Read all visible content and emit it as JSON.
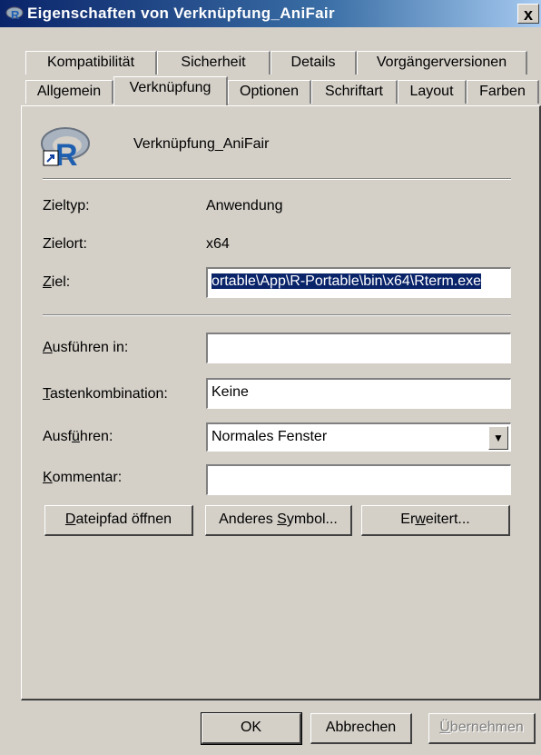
{
  "window": {
    "title": "Eigenschaften von Verknüpfung_AniFair",
    "close_label": "x"
  },
  "tabs_row1": [
    {
      "label": "Kompatibilität"
    },
    {
      "label": "Sicherheit"
    },
    {
      "label": "Details"
    },
    {
      "label": "Vorgängerversionen"
    }
  ],
  "tabs_row2": [
    {
      "label": "Allgemein"
    },
    {
      "label": "Verknüpfung",
      "active": true
    },
    {
      "label": "Optionen"
    },
    {
      "label": "Schriftart"
    },
    {
      "label": "Layout"
    },
    {
      "label": "Farben"
    }
  ],
  "shortcut": {
    "name": "Verknüpfung_AniFair",
    "icon": "r-app-shortcut-icon",
    "icon_letter": "R"
  },
  "fields": {
    "zieltyp_label": "Zieltyp:",
    "zieltyp_value": "Anwendung",
    "zielort_label": "Zielort:",
    "zielort_value": "x64",
    "ziel_label_hot": "Z",
    "ziel_label_rest": "iel:",
    "ziel_value": "ortable\\App\\R-Portable\\bin\\x64\\Rterm.exe",
    "ausfuehren_in_hot": "A",
    "ausfuehren_in_rest": "usführen in:",
    "ausfuehren_in_value": "",
    "tasten_hot": "T",
    "tasten_rest": "astenkombination:",
    "tasten_value": "Keine",
    "ausfuehren_pre": "Ausf",
    "ausfuehren_hot": "ü",
    "ausfuehren_post": "hren:",
    "ausfuehren_value": "Normales Fenster",
    "kommentar_hot": "K",
    "kommentar_rest": "ommentar:",
    "kommentar_value": ""
  },
  "buttons": {
    "dateipfad_hot": "D",
    "dateipfad_rest": "ateipfad öffnen",
    "symbol_pre": "Anderes ",
    "symbol_hot": "S",
    "symbol_post": "ymbol...",
    "erweitert_pre": "Er",
    "erweitert_hot": "w",
    "erweitert_post": "eitert...",
    "ok": "OK",
    "abbrechen": "Abbrechen",
    "uebernehmen_hot": "Ü",
    "uebernehmen_rest": "bernehmen"
  },
  "colors": {
    "title_bar": "#0a246a",
    "face": "#d4d0c8",
    "selection": "#0a246a"
  }
}
